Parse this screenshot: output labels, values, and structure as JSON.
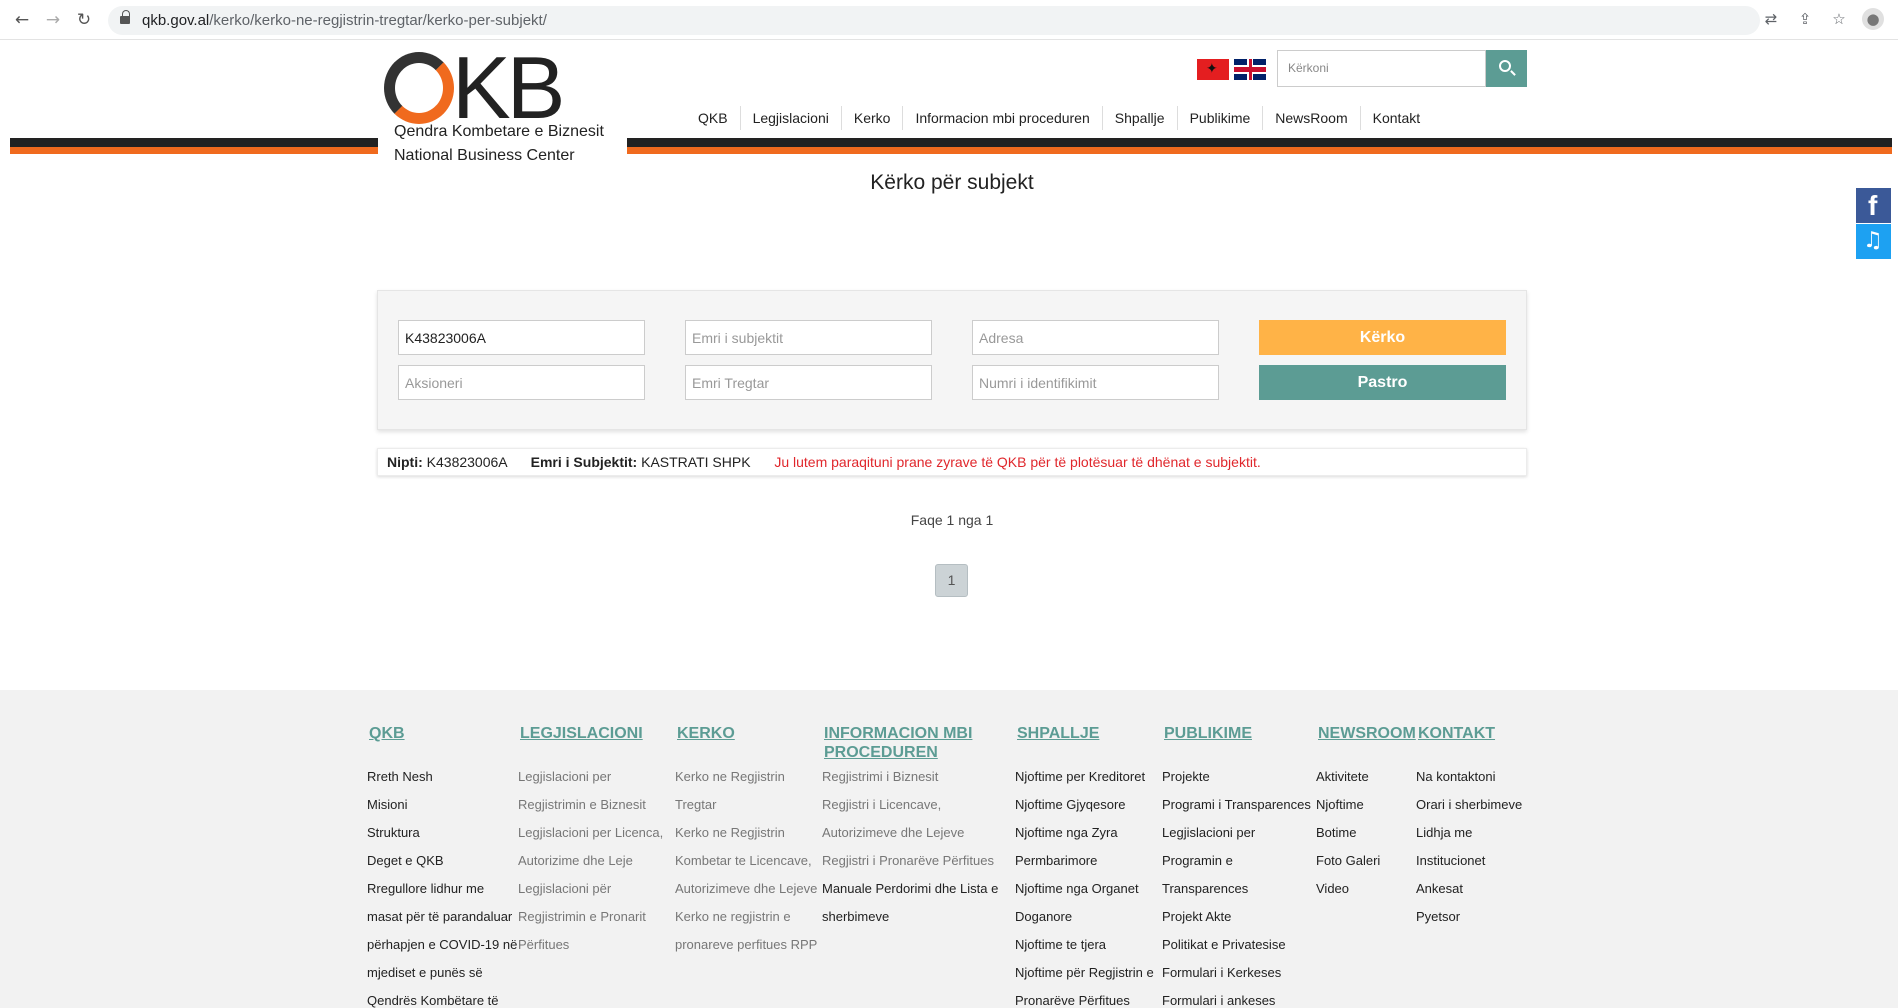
{
  "browser": {
    "url_host": "qkb.gov.al",
    "url_path": "/kerko/kerko-ne-regjistrin-tregtar/kerko-per-subjekt/"
  },
  "header": {
    "logo_mark": "QKB",
    "logo_line1": "Qendra Kombetare e Biznesit",
    "logo_line2": "National Business Center",
    "search_placeholder": "Kërkoni",
    "nav": [
      "QKB",
      "Legjislacioni",
      "Kerko",
      "Informacion mbi proceduren",
      "Shpallje",
      "Publikime",
      "NewsRoom",
      "Kontakt"
    ]
  },
  "page_title": "Kërko për subjekt",
  "form": {
    "nipt_value": "K43823006A",
    "name_placeholder": "Emri i subjektit",
    "address_placeholder": "Adresa",
    "shareholder_placeholder": "Aksioneri",
    "trade_name_placeholder": "Emri Tregtar",
    "id_number_placeholder": "Numri i identifikimit",
    "search_label": "Kërko",
    "clear_label": "Pastro"
  },
  "result": {
    "nipt_label": "Nipti:",
    "nipt_value": "K43823006A",
    "name_label": "Emri i Subjektit:",
    "name_value": "KASTRATI SHPK",
    "warning": "Ju lutem paraqituni prane zyrave të QKB për të plotësuar të dhënat e subjektit."
  },
  "pagination": {
    "summary": "Faqe 1 nga 1",
    "current_page": "1"
  },
  "footer": {
    "columns": [
      {
        "title": "QKB",
        "links": [
          "Rreth Nesh",
          "Misioni",
          "Struktura",
          "Deget e QKB",
          "Rregullore lidhur me",
          "masat për të parandaluar",
          "përhapjen e COVID-19 në",
          "mjediset e punës së",
          "Qendrës Kombëtare të"
        ]
      },
      {
        "title": "LEGJISLACIONI",
        "links": [
          "Legjislacioni per",
          "Regjistrimin e Biznesit",
          "Legjislacioni per Licenca,",
          "Autorizime dhe Leje",
          "Legjislacioni për",
          "Regjistrimin e Pronarit",
          "Përfitues"
        ]
      },
      {
        "title": "KERKO",
        "links": [
          "Kerko ne Regjistrin",
          "Tregtar",
          "Kerko ne Regjistrin",
          "Kombetar te Licencave,",
          "Autorizimeve dhe Lejeve",
          "Kerko ne regjistrin e",
          "pronareve perfitues RPP"
        ]
      },
      {
        "title": "INFORMACION MBI PROCEDUREN",
        "links": [
          "Regjistrimi i Biznesit",
          "Regjistri i Licencave,",
          "Autorizimeve dhe Lejeve",
          "Regjistri i Pronarëve Përfitues",
          "Manuale Perdorimi dhe Lista e",
          "sherbimeve"
        ]
      },
      {
        "title": "SHPALLJE",
        "links": [
          "Njoftime per Kreditoret",
          "Njoftime Gjyqesore",
          "Njoftime nga Zyra",
          "Permbarimore",
          "Njoftime nga Organet",
          "Doganore",
          "Njoftime te tjera",
          "Njoftime për Regjistrin e",
          "Pronarëve Përfitues"
        ]
      },
      {
        "title": "PUBLIKIME",
        "links": [
          "Projekte",
          "Programi i Transparences",
          "Legjislacioni per",
          "Programin e",
          "Transparences",
          "Projekt Akte",
          "Politikat e Privatesise",
          "Formulari i Kerkeses",
          "Formulari i ankeses"
        ]
      },
      {
        "title": "NEWSROOM",
        "links": [
          "Aktivitete",
          "Njoftime",
          "Botime",
          "Foto Galeri",
          "Video"
        ]
      },
      {
        "title": "KONTAKT",
        "links": [
          "Na kontaktoni",
          "Orari i sherbimeve",
          "Lidhja me",
          "Institucionet",
          "Ankesat",
          "Pyetsor"
        ]
      }
    ]
  },
  "colors": {
    "accent_teal": "#5c9c94",
    "accent_orange": "#f06a1e",
    "search_button": "#ffb347",
    "warning_red": "#e0272c"
  }
}
